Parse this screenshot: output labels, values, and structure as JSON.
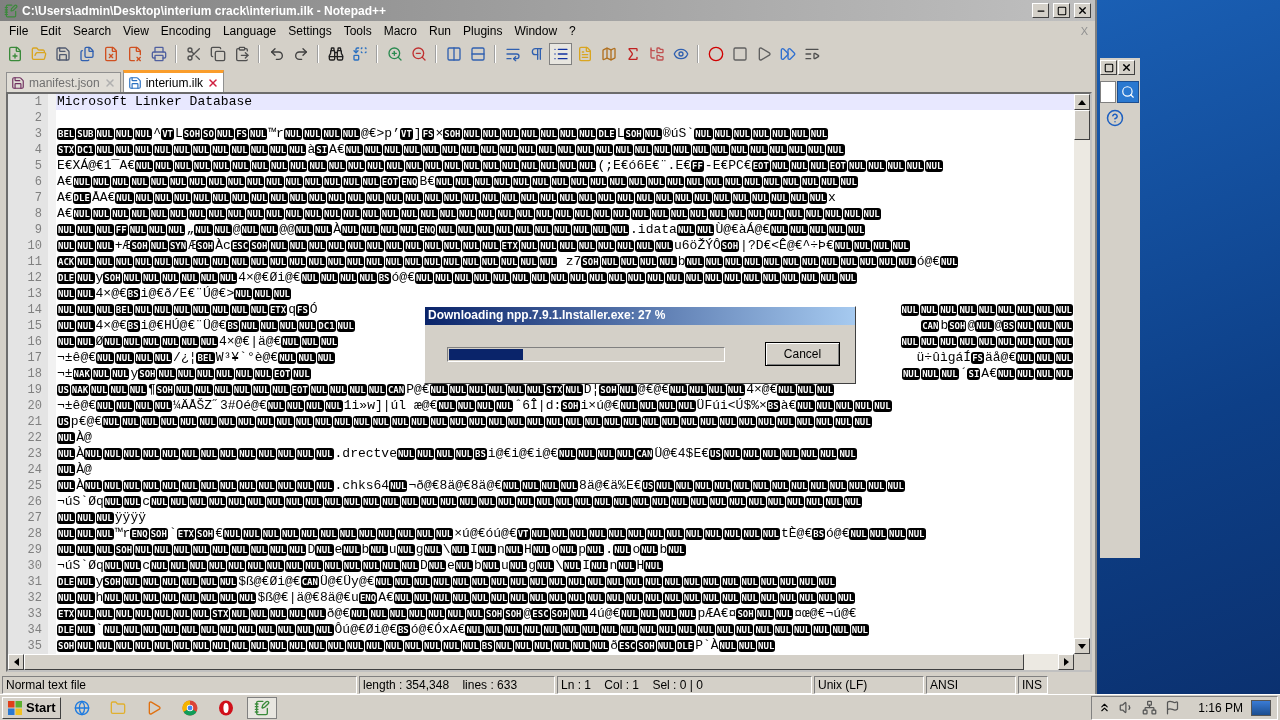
{
  "window": {
    "title": "C:\\Users\\admin\\Desktop\\interium crack\\interium.ilk - Notepad++"
  },
  "menu": [
    "File",
    "Edit",
    "Search",
    "View",
    "Encoding",
    "Language",
    "Settings",
    "Tools",
    "Macro",
    "Run",
    "Plugins",
    "Window",
    "?"
  ],
  "menu_close": "X",
  "toolbar": [
    {
      "kind": "new",
      "on": false
    },
    {
      "kind": "open",
      "on": false
    },
    {
      "kind": "save",
      "on": false
    },
    {
      "kind": "saveall",
      "on": false
    },
    {
      "kind": "close",
      "on": false
    },
    {
      "kind": "closeall",
      "on": false
    },
    {
      "kind": "print",
      "on": false
    },
    {
      "kind": "sep"
    },
    {
      "kind": "cut",
      "on": false
    },
    {
      "kind": "copy",
      "on": false
    },
    {
      "kind": "paste",
      "on": false
    },
    {
      "kind": "sep"
    },
    {
      "kind": "undo",
      "on": false
    },
    {
      "kind": "redo",
      "on": false
    },
    {
      "kind": "sep"
    },
    {
      "kind": "find",
      "on": false
    },
    {
      "kind": "replace",
      "on": false
    },
    {
      "kind": "sep"
    },
    {
      "kind": "zoomin",
      "on": false
    },
    {
      "kind": "zoomout",
      "on": false
    },
    {
      "kind": "sep"
    },
    {
      "kind": "syncv",
      "on": false
    },
    {
      "kind": "synch",
      "on": false
    },
    {
      "kind": "sep"
    },
    {
      "kind": "wrap",
      "on": false
    },
    {
      "kind": "allchars",
      "on": false
    },
    {
      "kind": "indent",
      "on": true
    },
    {
      "kind": "udl",
      "on": false
    },
    {
      "kind": "docmap",
      "on": false
    },
    {
      "kind": "funclist",
      "on": false
    },
    {
      "kind": "folder",
      "on": false
    },
    {
      "kind": "monitor",
      "on": false
    },
    {
      "kind": "sep"
    },
    {
      "kind": "record",
      "on": false
    },
    {
      "kind": "stop",
      "on": false
    },
    {
      "kind": "play",
      "on": false
    },
    {
      "kind": "playmulti",
      "on": false
    },
    {
      "kind": "savemacro",
      "on": false
    }
  ],
  "tabs": [
    {
      "label": "manifest.json",
      "selected": false
    },
    {
      "label": "interium.ilk",
      "selected": true
    }
  ],
  "editor": {
    "lines": [
      {
        "number": "1",
        "current": true,
        "segments": [
          {
            "kind": "text",
            "text": "Microsoft Linker Database"
          }
        ]
      },
      {
        "number": "2",
        "current": false
      },
      {
        "number": "3",
        "current": false,
        "segments": [
          {
            "kind": "ctrl",
            "text": "BEL SUB NUL NUL NUL"
          },
          {
            "kind": "text",
            "text": "^"
          },
          {
            "kind": "ctrl",
            "text": "VT"
          },
          {
            "kind": "text",
            "text": "L"
          },
          {
            "kind": "ctrl",
            "text": "SOH SO NUL FS NUL"
          },
          {
            "kind": "text",
            "text": "™r"
          },
          {
            "kind": "ctrl",
            "text": "NUL NUL NUL NUL"
          },
          {
            "kind": "text",
            "text": "@€>p’"
          },
          {
            "kind": "ctrl",
            "text": "VT"
          },
          {
            "kind": "text",
            "text": "]"
          },
          {
            "kind": "ctrl",
            "text": "FS"
          },
          {
            "kind": "text",
            "text": "×"
          },
          {
            "kind": "ctrl",
            "text": "SOH NUL NUL NUL NUL NUL NUL NUL DLE"
          },
          {
            "kind": "text",
            "text": "L"
          },
          {
            "kind": "ctrl",
            "text": "SOH NUL"
          },
          {
            "kind": "text",
            "text": "®úS`"
          },
          {
            "kind": "ctrl",
            "text": "NUL NUL NUL NUL NUL NUL NUL"
          }
        ]
      },
      {
        "number": "4",
        "current": false,
        "segments": [
          {
            "kind": "ctrl",
            "text": "STX DC1 NUL NUL NUL NUL NUL NUL NUL NUL NUL NUL NUL"
          },
          {
            "kind": "text",
            "text": "à"
          },
          {
            "kind": "ctrl",
            "text": "SI"
          },
          {
            "kind": "text",
            "text": "A€"
          },
          {
            "kind": "ctrl",
            "text": "NUL NUL NUL NUL NUL NUL NUL NUL NUL NUL NUL NUL NUL NUL NUL NUL NUL NUL NUL NUL NUL NUL NUL NUL NUL NUL"
          }
        ]
      },
      {
        "number": "5",
        "current": false,
        "segments": [
          {
            "kind": "text",
            "text": "E€XÁ@€1¯A€"
          },
          {
            "kind": "ctrl",
            "text": "NUL NUL NUL NUL NUL NUL NUL NUL NUL NUL NUL NUL NUL NUL NUL NUL NUL NUL NUL NUL NUL NUL NUL NUL"
          },
          {
            "kind": "text",
            "text": "(;E€ó6E€¨.E€"
          },
          {
            "kind": "ctrl",
            "text": "FF"
          },
          {
            "kind": "text",
            "text": "-E€PC€"
          },
          {
            "kind": "ctrl",
            "text": "EOT NUL NUL NUL EOT NUL NUL NUL NUL NUL"
          }
        ]
      },
      {
        "number": "6",
        "current": false,
        "segments": [
          {
            "kind": "text",
            "text": "A€"
          },
          {
            "kind": "ctrl",
            "text": "NUL NUL NUL NUL NUL NUL NUL NUL NUL NUL NUL NUL NUL NUL NUL NUL EOT ENQ"
          },
          {
            "kind": "text",
            "text": "B€"
          },
          {
            "kind": "ctrl",
            "text": "NUL NUL NUL NUL NUL NUL NUL NUL NUL NUL NUL NUL NUL NUL NUL NUL NUL NUL NUL NUL NUL NUL"
          }
        ]
      },
      {
        "number": "7",
        "current": false,
        "segments": [
          {
            "kind": "text",
            "text": "A€"
          },
          {
            "kind": "ctrl",
            "text": "DLE"
          },
          {
            "kind": "text",
            "text": "ÅA€"
          },
          {
            "kind": "ctrl",
            "text": "NUL NUL NUL NUL NUL NUL NUL NUL NUL NUL NUL NUL NUL NUL NUL NUL NUL NUL NUL NUL NUL NUL NUL NUL NUL NUL NUL NUL NUL NUL NUL NUL NUL NUL NUL NUL NUL"
          },
          {
            "kind": "text",
            "text": "x"
          }
        ]
      },
      {
        "number": "8",
        "current": false,
        "segments": [
          {
            "kind": "text",
            "text": "A€"
          },
          {
            "kind": "ctrl",
            "text": "NUL NUL NUL NUL NUL NUL NUL NUL NUL NUL NUL NUL NUL NUL NUL NUL NUL NUL NUL NUL NUL NUL NUL NUL NUL NUL NUL NUL NUL NUL NUL NUL NUL NUL NUL NUL NUL NUL NUL NUL NUL NUL"
          }
        ]
      },
      {
        "number": "9",
        "current": false,
        "segments": [
          {
            "kind": "ctrl",
            "text": "NUL NUL NUL FF NUL NUL NUL"
          },
          {
            "kind": "text",
            "text": "„"
          },
          {
            "kind": "ctrl",
            "text": "NUL NUL"
          },
          {
            "kind": "text",
            "text": "@"
          },
          {
            "kind": "ctrl",
            "text": "NUL NUL"
          },
          {
            "kind": "text",
            "text": "@@"
          },
          {
            "kind": "ctrl",
            "text": "NUL NUL"
          },
          {
            "kind": "text",
            "text": "À"
          },
          {
            "kind": "ctrl",
            "text": "NUL NUL NUL NUL ENQ NUL NUL NUL NUL NUL NUL NUL NUL NUL NUL"
          },
          {
            "kind": "text",
            "text": ".idata"
          },
          {
            "kind": "ctrl",
            "text": "NUL NUL"
          },
          {
            "kind": "text",
            "text": "Ù@€àÁ@€"
          },
          {
            "kind": "ctrl",
            "text": "NUL NUL NUL NUL NUL"
          }
        ]
      },
      {
        "number": "10",
        "current": false,
        "segments": [
          {
            "kind": "ctrl",
            "text": "NUL NUL NUL"
          },
          {
            "kind": "text",
            "text": "+Æ"
          },
          {
            "kind": "ctrl",
            "text": "SOH NUL SYN"
          },
          {
            "kind": "text",
            "text": "Æ"
          },
          {
            "kind": "ctrl",
            "text": "SOH"
          },
          {
            "kind": "text",
            "text": "Àc"
          },
          {
            "kind": "ctrl",
            "text": "ESC SOH NUL NUL NUL NUL NUL NUL NUL NUL NUL NUL NUL NUL ETX NUL NUL NUL NUL NUL NUL NUL NUL"
          },
          {
            "kind": "text",
            "text": "u6öŽÝÔ"
          },
          {
            "kind": "ctrl",
            "text": "SOH"
          },
          {
            "kind": "text",
            "text": "|?D€<Ê@€^÷Þ€"
          },
          {
            "kind": "ctrl",
            "text": "NUL NUL NUL NUL"
          }
        ]
      },
      {
        "number": "11",
        "current": false,
        "segments": [
          {
            "kind": "ctrl",
            "text": "ACK NUL NUL NUL NUL NUL NUL NUL NUL NUL NUL NUL NUL NUL NUL NUL NUL NUL NUL NUL NUL NUL NUL NUL NUL NUL"
          },
          {
            "kind": "text",
            "text": " z7"
          },
          {
            "kind": "ctrl",
            "text": "SOH NUL NUL NUL NUL"
          },
          {
            "kind": "text",
            "text": "b"
          },
          {
            "kind": "ctrl",
            "text": "NUL NUL NUL NUL NUL NUL NUL NUL NUL NUL NUL NUL"
          },
          {
            "kind": "text",
            "text": "ó@€"
          },
          {
            "kind": "ctrl",
            "text": "NUL"
          }
        ]
      },
      {
        "number": "12",
        "current": false,
        "segments": [
          {
            "kind": "ctrl",
            "text": "DLE NUL"
          },
          {
            "kind": "text",
            "text": "y"
          },
          {
            "kind": "ctrl",
            "text": "SOH NUL NUL NUL NUL NUL NUL"
          },
          {
            "kind": "text",
            "text": "4×@€Øi@€"
          },
          {
            "kind": "ctrl",
            "text": "NUL NUL NUL NUL BS"
          },
          {
            "kind": "text",
            "text": "ó@€"
          },
          {
            "kind": "ctrl",
            "text": "NUL NUL NUL NUL NUL NUL NUL NUL NUL NUL NUL NUL NUL NUL NUL NUL NUL NUL NUL NUL NUL NUL NUL"
          }
        ]
      },
      {
        "number": "13",
        "current": false,
        "segments": [
          {
            "kind": "ctrl",
            "text": "NUL NUL"
          },
          {
            "kind": "text",
            "text": "4×@€"
          },
          {
            "kind": "ctrl",
            "text": "BS"
          },
          {
            "kind": "text",
            "text": "i@€ð/E€¨Ú@€>"
          },
          {
            "kind": "ctrl",
            "text": "NUL NUL NUL"
          }
        ]
      },
      {
        "number": "14",
        "current": false,
        "segments": [
          {
            "kind": "ctrl",
            "text": "NUL NUL NUL BEL NUL NUL NUL NUL NUL NUL NUL ETX"
          },
          {
            "kind": "text",
            "text": "q"
          },
          {
            "kind": "ctrl",
            "text": "FS"
          },
          {
            "kind": "text",
            "text": "Ó"
          }
        ],
        "right": [
          {
            "kind": "ctrl",
            "text": "NUL NUL NUL NUL NUL NUL NUL NUL NUL"
          }
        ]
      },
      {
        "number": "15",
        "current": false,
        "segments": [
          {
            "kind": "ctrl",
            "text": "NUL NUL"
          },
          {
            "kind": "text",
            "text": "4×@€"
          },
          {
            "kind": "ctrl",
            "text": "BS"
          },
          {
            "kind": "text",
            "text": "i@€HÚ@€¨Ü@€"
          },
          {
            "kind": "ctrl",
            "text": "BS NUL NUL NUL NUL DC1 NUL"
          }
        ],
        "right": [
          {
            "kind": "ctrl",
            "text": "CAN"
          },
          {
            "kind": "text",
            "text": "b"
          },
          {
            "kind": "ctrl",
            "text": "SOH"
          },
          {
            "kind": "text",
            "text": "@"
          },
          {
            "kind": "ctrl",
            "text": "NUL"
          },
          {
            "kind": "text",
            "text": "@"
          },
          {
            "kind": "ctrl",
            "text": "BS NUL NUL NUL"
          }
        ]
      },
      {
        "number": "16",
        "current": false,
        "segments": [
          {
            "kind": "ctrl",
            "text": "NUL NUL"
          },
          {
            "kind": "text",
            "text": "Ø"
          },
          {
            "kind": "ctrl",
            "text": "NUL NUL NUL NUL NUL NUL"
          },
          {
            "kind": "text",
            "text": "4×@€|ä@€"
          },
          {
            "kind": "ctrl",
            "text": "NUL NUL NUL"
          }
        ],
        "right": [
          {
            "kind": "ctrl",
            "text": "NUL NUL NUL NUL NUL NUL NUL NUL NUL"
          }
        ]
      },
      {
        "number": "17",
        "current": false,
        "segments": [
          {
            "kind": "text",
            "text": "¬±ê@€"
          },
          {
            "kind": "ctrl",
            "text": "NUL NUL NUL NUL"
          },
          {
            "kind": "text",
            "text": "/¿¦"
          },
          {
            "kind": "ctrl",
            "text": "BEL"
          },
          {
            "kind": "text",
            "text": "W³¥`°è@€"
          },
          {
            "kind": "ctrl",
            "text": "NUL NUL NUL"
          }
        ],
        "right": [
          {
            "kind": "text",
            "text": "ü÷ûìgáÍ"
          },
          {
            "kind": "ctrl",
            "text": "FS"
          },
          {
            "kind": "text",
            "text": "äå@€"
          },
          {
            "kind": "ctrl",
            "text": "NUL NUL NUL"
          }
        ]
      },
      {
        "number": "18",
        "current": false,
        "segments": [
          {
            "kind": "text",
            "text": "¬±"
          },
          {
            "kind": "ctrl",
            "text": "NAK NUL NUL"
          },
          {
            "kind": "text",
            "text": "y"
          },
          {
            "kind": "ctrl",
            "text": "SOH NUL NUL NUL NUL NUL NUL EOT NUL"
          }
        ],
        "right": [
          {
            "kind": "ctrl",
            "text": "NUL NUL NUL"
          },
          {
            "kind": "text",
            "text": "´"
          },
          {
            "kind": "ctrl",
            "text": "SI"
          },
          {
            "kind": "text",
            "text": "A€"
          },
          {
            "kind": "ctrl",
            "text": "NUL NUL NUL NUL"
          }
        ]
      },
      {
        "number": "19",
        "current": false,
        "segments": [
          {
            "kind": "ctrl",
            "text": "US NAK NUL NUL NUL"
          },
          {
            "kind": "text",
            "text": "¶"
          },
          {
            "kind": "ctrl",
            "text": "SOH NUL NUL NUL NUL NUL NUL EOT NUL NUL NUL NUL CAN"
          },
          {
            "kind": "text",
            "text": "P@€"
          },
          {
            "kind": "ctrl",
            "text": "NUL NUL NUL NUL NUL NUL STX NUL"
          },
          {
            "kind": "text",
            "text": "D¦"
          },
          {
            "kind": "ctrl",
            "text": "SOH NUL"
          },
          {
            "kind": "text",
            "text": "@€@€"
          },
          {
            "kind": "ctrl",
            "text": "NUL NUL NUL NUL"
          },
          {
            "kind": "text",
            "text": "4×@€"
          },
          {
            "kind": "ctrl",
            "text": "NUL NUL NUL"
          }
        ]
      },
      {
        "number": "20",
        "current": false,
        "segments": [
          {
            "kind": "text",
            "text": "¬±ê@€"
          },
          {
            "kind": "ctrl",
            "text": "NUL NUL NUL NUL"
          },
          {
            "kind": "text",
            "text": "¼ÄÅŠZ˝3#Oé@€"
          },
          {
            "kind": "ctrl",
            "text": "NUL NUL NUL NUL"
          },
          {
            "kind": "text",
            "text": "1i»w]|úl æ@€"
          },
          {
            "kind": "ctrl",
            "text": "NUL NUL NUL NUL"
          },
          {
            "kind": "text",
            "text": "ˆ6Î|d:"
          },
          {
            "kind": "ctrl",
            "text": "SOH"
          },
          {
            "kind": "text",
            "text": "i×ú@€"
          },
          {
            "kind": "ctrl",
            "text": "NUL NUL NUL NUL"
          },
          {
            "kind": "text",
            "text": "ÜFúi<Ú$%×"
          },
          {
            "kind": "ctrl",
            "text": "BS"
          },
          {
            "kind": "text",
            "text": "à€"
          },
          {
            "kind": "ctrl",
            "text": "NUL NUL NUL NUL NUL"
          }
        ]
      },
      {
        "number": "21",
        "current": false,
        "segments": [
          {
            "kind": "ctrl",
            "text": "US"
          },
          {
            "kind": "text",
            "text": "p€@€"
          },
          {
            "kind": "ctrl",
            "text": "NUL NUL NUL NUL NUL NUL NUL NUL NUL NUL NUL NUL NUL NUL NUL NUL NUL NUL NUL NUL NUL NUL NUL NUL NUL NUL NUL NUL NUL NUL NUL NUL NUL NUL NUL NUL NUL NUL NUL NUL"
          }
        ]
      },
      {
        "number": "22",
        "current": false,
        "segments": [
          {
            "kind": "ctrl",
            "text": "NUL"
          },
          {
            "kind": "text",
            "text": "À@"
          }
        ]
      },
      {
        "number": "23",
        "current": false,
        "segments": [
          {
            "kind": "ctrl",
            "text": "NUL"
          },
          {
            "kind": "text",
            "text": "À"
          },
          {
            "kind": "ctrl",
            "text": "NUL NUL NUL NUL NUL NUL NUL NUL NUL NUL NUL NUL NUL"
          },
          {
            "kind": "text",
            "text": ".drectve"
          },
          {
            "kind": "ctrl",
            "text": "NUL NUL NUL NUL BS"
          },
          {
            "kind": "text",
            "text": "i@€i@€i@€"
          },
          {
            "kind": "ctrl",
            "text": "NUL NUL NUL NUL CAN"
          },
          {
            "kind": "text",
            "text": "Ü@€4$E€"
          },
          {
            "kind": "ctrl",
            "text": "US NUL NUL NUL NUL NUL NUL NUL"
          }
        ]
      },
      {
        "number": "24",
        "current": false,
        "segments": [
          {
            "kind": "ctrl",
            "text": "NUL"
          },
          {
            "kind": "text",
            "text": "À@"
          }
        ]
      },
      {
        "number": "25",
        "current": false,
        "segments": [
          {
            "kind": "ctrl",
            "text": "NUL"
          },
          {
            "kind": "text",
            "text": "À"
          },
          {
            "kind": "ctrl",
            "text": "NUL NUL NUL NUL NUL NUL NUL NUL NUL NUL NUL NUL NUL"
          },
          {
            "kind": "text",
            "text": ".chks64"
          },
          {
            "kind": "ctrl",
            "text": "NUL"
          },
          {
            "kind": "text",
            "text": "¬ð@€8ä@€8ä@€"
          },
          {
            "kind": "ctrl",
            "text": "NUL NUL NUL NUL"
          },
          {
            "kind": "text",
            "text": "8ä@€ä%E€"
          },
          {
            "kind": "ctrl",
            "text": "US NUL NUL NUL NUL NUL NUL NUL NUL NUL NUL NUL NUL NUL"
          }
        ]
      },
      {
        "number": "26",
        "current": false,
        "segments": [
          {
            "kind": "text",
            "text": "¬úS`Øq"
          },
          {
            "kind": "ctrl",
            "text": "NUL NUL"
          },
          {
            "kind": "text",
            "text": "c"
          },
          {
            "kind": "ctrl",
            "text": "NUL NUL NUL NUL NUL NUL NUL NUL NUL NUL NUL NUL NUL NUL NUL NUL NUL NUL NUL NUL NUL NUL NUL NUL NUL NUL NUL NUL NUL NUL NUL NUL NUL NUL NUL NUL NUL"
          }
        ]
      },
      {
        "number": "27",
        "current": false,
        "segments": [
          {
            "kind": "ctrl",
            "text": "NUL NUL NUL"
          },
          {
            "kind": "text",
            "text": "ÿÿÿÿ"
          }
        ]
      },
      {
        "number": "28",
        "current": false,
        "segments": [
          {
            "kind": "ctrl",
            "text": "NUL NUL NUL"
          },
          {
            "kind": "text",
            "text": "™r"
          },
          {
            "kind": "ctrl",
            "text": "ENQ SOH"
          },
          {
            "kind": "text",
            "text": "`"
          },
          {
            "kind": "ctrl",
            "text": "ETX SOH"
          },
          {
            "kind": "text",
            "text": "€"
          },
          {
            "kind": "ctrl",
            "text": "NUL NUL NUL NUL NUL NUL NUL NUL NUL NUL NUL NUL"
          },
          {
            "kind": "text",
            "text": "×ú@€óú@€"
          },
          {
            "kind": "ctrl",
            "text": "VT NUL NUL NUL NUL NUL NUL NUL NUL NUL NUL NUL NUL NUL"
          },
          {
            "kind": "text",
            "text": "tÈ@€"
          },
          {
            "kind": "ctrl",
            "text": "BS"
          },
          {
            "kind": "text",
            "text": "ó@€"
          },
          {
            "kind": "ctrl",
            "text": "NUL NUL NUL NUL"
          }
        ]
      },
      {
        "number": "29",
        "current": false,
        "segments": [
          {
            "kind": "ctrl",
            "text": "NUL NUL NUL SOH NUL NUL NUL NUL NUL NUL NUL NUL NUL"
          },
          {
            "kind": "text",
            "text": "D"
          },
          {
            "kind": "ctrl",
            "text": "NUL"
          },
          {
            "kind": "text",
            "text": "e"
          },
          {
            "kind": "ctrl",
            "text": "NUL"
          },
          {
            "kind": "text",
            "text": "b"
          },
          {
            "kind": "ctrl",
            "text": "NUL"
          },
          {
            "kind": "text",
            "text": "u"
          },
          {
            "kind": "ctrl",
            "text": "NUL"
          },
          {
            "kind": "text",
            "text": "g"
          },
          {
            "kind": "ctrl",
            "text": "NUL"
          },
          {
            "kind": "text",
            "text": "\\"
          },
          {
            "kind": "ctrl",
            "text": "NUL"
          },
          {
            "kind": "text",
            "text": "I"
          },
          {
            "kind": "ctrl",
            "text": "NUL"
          },
          {
            "kind": "text",
            "text": "n"
          },
          {
            "kind": "ctrl",
            "text": "NUL"
          },
          {
            "kind": "text",
            "text": "H"
          },
          {
            "kind": "ctrl",
            "text": "NUL"
          },
          {
            "kind": "text",
            "text": "o"
          },
          {
            "kind": "ctrl",
            "text": "NUL"
          },
          {
            "kind": "text",
            "text": "p"
          },
          {
            "kind": "ctrl",
            "text": "NUL"
          },
          {
            "kind": "text",
            "text": "."
          },
          {
            "kind": "ctrl",
            "text": "NUL"
          },
          {
            "kind": "text",
            "text": "o"
          },
          {
            "kind": "ctrl",
            "text": "NUL"
          },
          {
            "kind": "text",
            "text": "b"
          },
          {
            "kind": "ctrl",
            "text": "NUL"
          }
        ]
      },
      {
        "number": "30",
        "current": false,
        "segments": [
          {
            "kind": "text",
            "text": "¬úS`Øq"
          },
          {
            "kind": "ctrl",
            "text": "NUL NUL"
          },
          {
            "kind": "text",
            "text": "c"
          },
          {
            "kind": "ctrl",
            "text": "NUL NUL NUL NUL NUL NUL NUL NUL NUL NUL NUL NUL NUL NUL"
          },
          {
            "kind": "text",
            "text": "D"
          },
          {
            "kind": "ctrl",
            "text": "NUL"
          },
          {
            "kind": "text",
            "text": "e"
          },
          {
            "kind": "ctrl",
            "text": "NUL"
          },
          {
            "kind": "text",
            "text": "b"
          },
          {
            "kind": "ctrl",
            "text": "NUL"
          },
          {
            "kind": "text",
            "text": "u"
          },
          {
            "kind": "ctrl",
            "text": "NUL"
          },
          {
            "kind": "text",
            "text": "g"
          },
          {
            "kind": "ctrl",
            "text": "NUL"
          },
          {
            "kind": "text",
            "text": "\\"
          },
          {
            "kind": "ctrl",
            "text": "NUL"
          },
          {
            "kind": "text",
            "text": "I"
          },
          {
            "kind": "ctrl",
            "text": "NUL"
          },
          {
            "kind": "text",
            "text": "n"
          },
          {
            "kind": "ctrl",
            "text": "NUL"
          },
          {
            "kind": "text",
            "text": "H"
          },
          {
            "kind": "ctrl",
            "text": "NUL"
          }
        ]
      },
      {
        "number": "31",
        "current": false,
        "segments": [
          {
            "kind": "ctrl",
            "text": "DLE NUL"
          },
          {
            "kind": "text",
            "text": "y"
          },
          {
            "kind": "ctrl",
            "text": "SOH NUL NUL NUL NUL NUL NUL"
          },
          {
            "kind": "text",
            "text": "$ß@€Øi@€"
          },
          {
            "kind": "ctrl",
            "text": "CAN"
          },
          {
            "kind": "text",
            "text": "Ü@€Üy@€"
          },
          {
            "kind": "ctrl",
            "text": "NUL NUL NUL NUL NUL NUL NUL NUL NUL NUL NUL NUL NUL NUL NUL NUL NUL NUL NUL NUL NUL NUL NUL NUL"
          }
        ]
      },
      {
        "number": "32",
        "current": false,
        "segments": [
          {
            "kind": "ctrl",
            "text": "NUL NUL"
          },
          {
            "kind": "text",
            "text": "h"
          },
          {
            "kind": "ctrl",
            "text": "NUL NUL NUL NUL NUL NUL NUL NUL"
          },
          {
            "kind": "text",
            "text": "$ß@€|ä@€8ä@€u"
          },
          {
            "kind": "ctrl",
            "text": "ENQ"
          },
          {
            "kind": "text",
            "text": "A€"
          },
          {
            "kind": "ctrl",
            "text": "NUL NUL NUL NUL NUL NUL NUL NUL NUL NUL NUL NUL NUL NUL NUL NUL NUL NUL NUL NUL NUL NUL NUL NUL"
          }
        ]
      },
      {
        "number": "33",
        "current": false,
        "segments": [
          {
            "kind": "ctrl",
            "text": "ETX NUL NUL NUL NUL NUL NUL NUL STX NUL NUL NUL NUL NUL"
          },
          {
            "kind": "text",
            "text": "ð@€"
          },
          {
            "kind": "ctrl",
            "text": "NUL NUL NUL NUL NUL NUL NUL SOH SOH"
          },
          {
            "kind": "text",
            "text": "@"
          },
          {
            "kind": "ctrl",
            "text": "ESC SOH NUL"
          },
          {
            "kind": "text",
            "text": "4ú@€"
          },
          {
            "kind": "ctrl",
            "text": "NUL NUL NUL NUL"
          },
          {
            "kind": "text",
            "text": "pÆA€¤"
          },
          {
            "kind": "ctrl",
            "text": "SOH NUL NUL"
          },
          {
            "kind": "text",
            "text": "¤œ@€¬ú@€"
          }
        ]
      },
      {
        "number": "34",
        "current": false,
        "segments": [
          {
            "kind": "ctrl",
            "text": "DLE NUL"
          },
          {
            "kind": "text",
            "text": "`"
          },
          {
            "kind": "ctrl",
            "text": "NUL NUL NUL NUL NUL NUL NUL NUL NUL NUL NUL NUL"
          },
          {
            "kind": "text",
            "text": "Ôú@€Øi@€"
          },
          {
            "kind": "ctrl",
            "text": "BS"
          },
          {
            "kind": "text",
            "text": "ó@€ÓxA€"
          },
          {
            "kind": "ctrl",
            "text": "NUL NUL NUL NUL NUL NUL NUL NUL NUL NUL NUL NUL NUL NUL NUL NUL NUL NUL NUL NUL NUL"
          }
        ]
      },
      {
        "number": "35",
        "current": false,
        "segments": [
          {
            "kind": "ctrl",
            "text": "SOH NUL NUL NUL NUL NUL NUL NUL NUL NUL NUL NUL NUL NUL NUL NUL NUL NUL NUL NUL NUL NUL BS NUL NUL NUL NUL NUL NUL"
          },
          {
            "kind": "text",
            "text": "ð"
          },
          {
            "kind": "ctrl",
            "text": "ESC SOH NUL DLE"
          },
          {
            "kind": "text",
            "text": "P`À"
          },
          {
            "kind": "ctrl",
            "text": "NUL NUL NUL"
          }
        ]
      }
    ]
  },
  "dialog": {
    "title": "Downloading npp.7.9.1.Installer.exe: 27 %",
    "level": 0.27,
    "button": "Cancel"
  },
  "status_bar": [
    "Normal text file",
    "length : 354,348    lines : 633",
    "Ln : 1    Col : 1    Sel : 0 | 0",
    "Unix (LF)",
    "ANSI",
    "INS"
  ],
  "taskbar": {
    "start": "Start",
    "apps": [
      {
        "kind": "ie",
        "selected": false
      },
      {
        "kind": "explorer",
        "selected": false
      },
      {
        "kind": "media",
        "selected": false
      },
      {
        "kind": "chrome",
        "selected": false
      },
      {
        "kind": "opera",
        "selected": false
      },
      {
        "kind": "notepad",
        "selected": true
      }
    ],
    "clock": "1:16 PM"
  }
}
